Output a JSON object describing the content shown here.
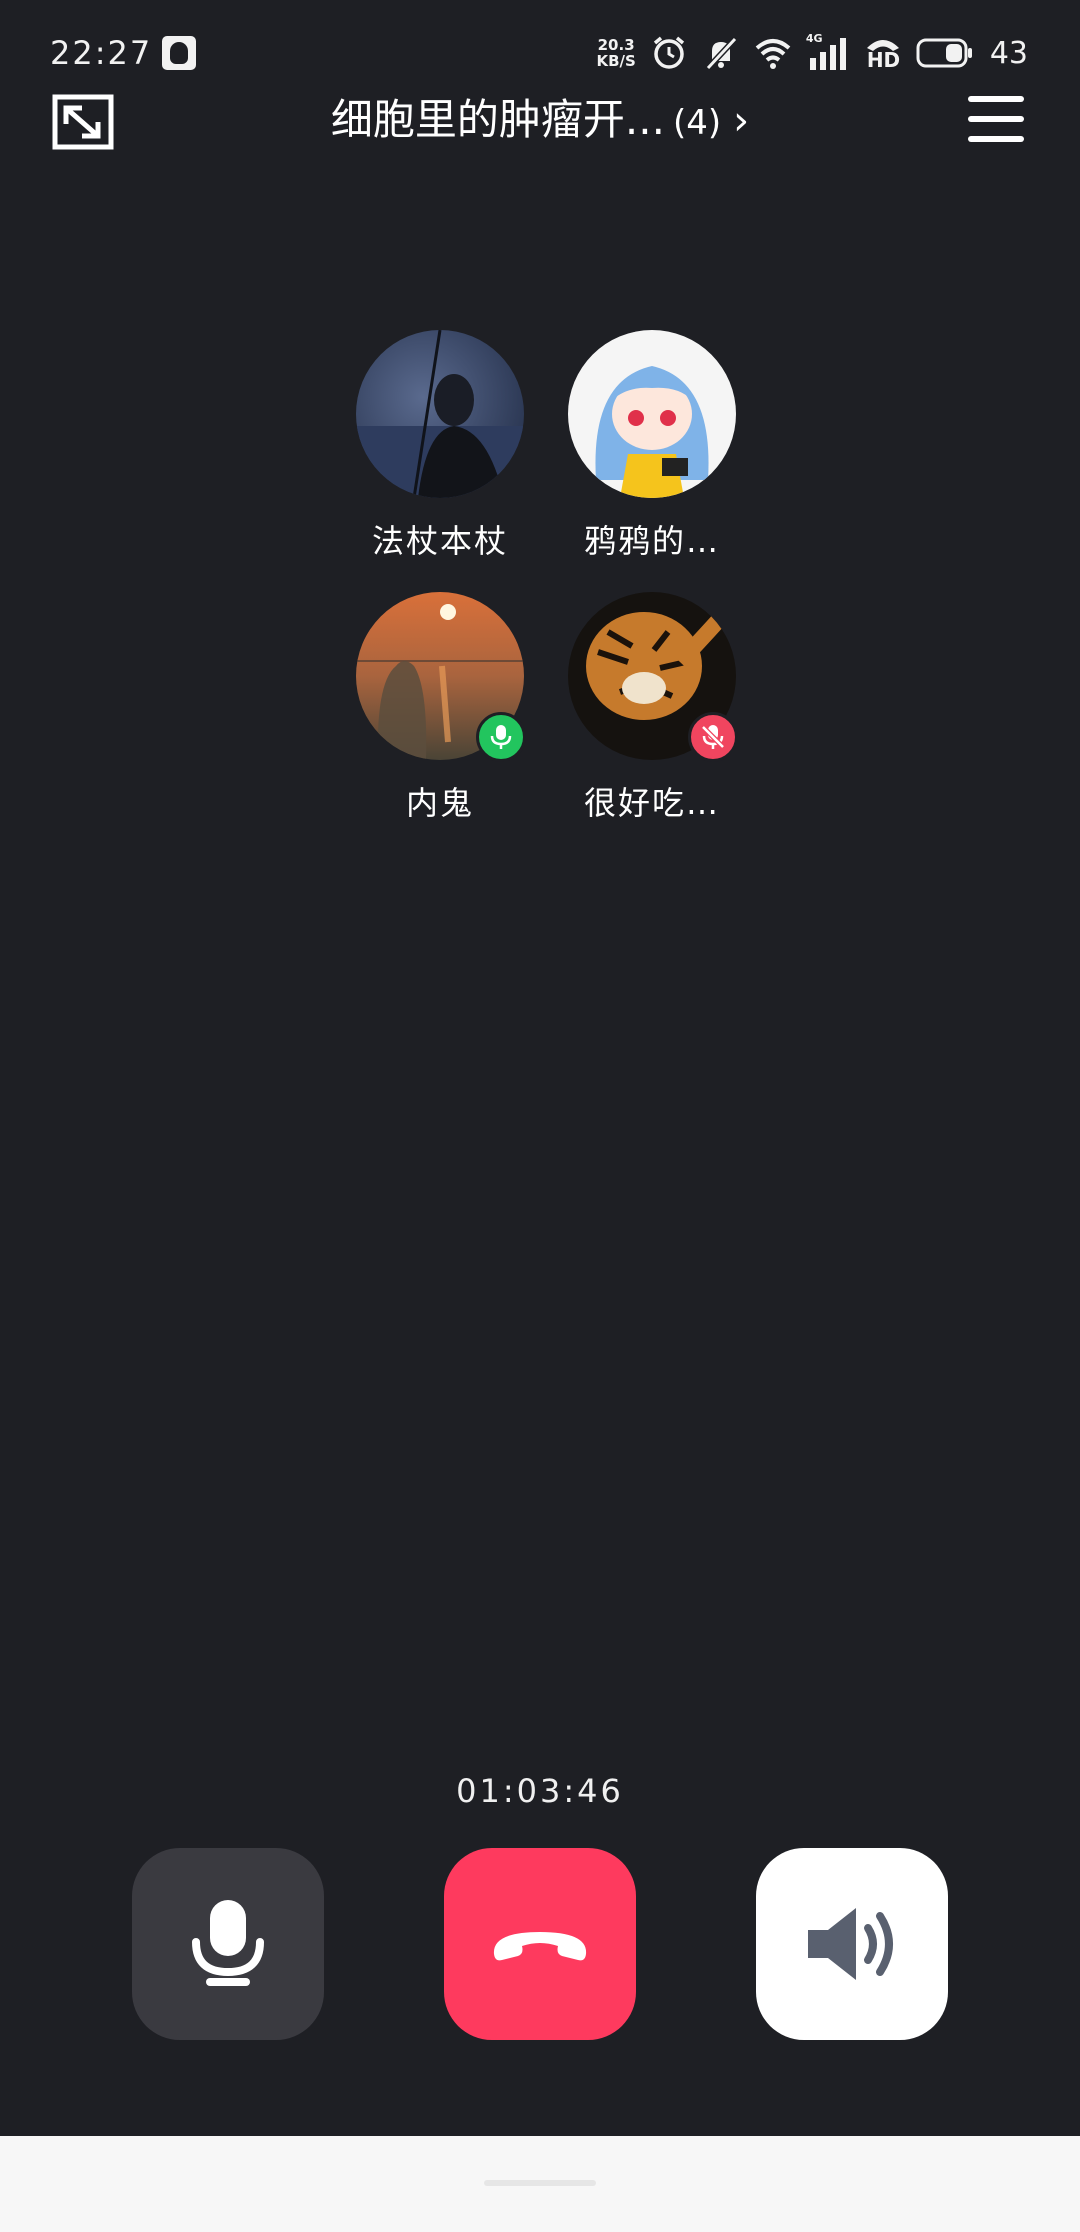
{
  "status_bar": {
    "time": "22:27",
    "net_speed_value": "20.3",
    "net_speed_unit": "KB/S",
    "network": "4G",
    "hd": "HD",
    "battery": "43",
    "icons": [
      "qq-icon",
      "alarm-icon",
      "mute-bell-icon",
      "wifi-icon",
      "signal-icon",
      "hd-call-icon",
      "battery-icon"
    ]
  },
  "header": {
    "title": "细胞里的肿瘤开...",
    "member_count": "(4)",
    "chevron": "›"
  },
  "participants": [
    {
      "name": "法杖本杖",
      "mic": "none"
    },
    {
      "name": "鸦鸦的…",
      "mic": "none"
    },
    {
      "name": "内鬼",
      "mic": "on"
    },
    {
      "name": "很好吃…",
      "mic": "muted"
    }
  ],
  "call": {
    "duration": "01:03:46"
  },
  "colors": {
    "background": "#1e1f24",
    "hangup": "#fe3a5e",
    "mic_on": "#22c55e",
    "mic_muted": "#f0455f",
    "control_dark": "#3a3a40"
  }
}
